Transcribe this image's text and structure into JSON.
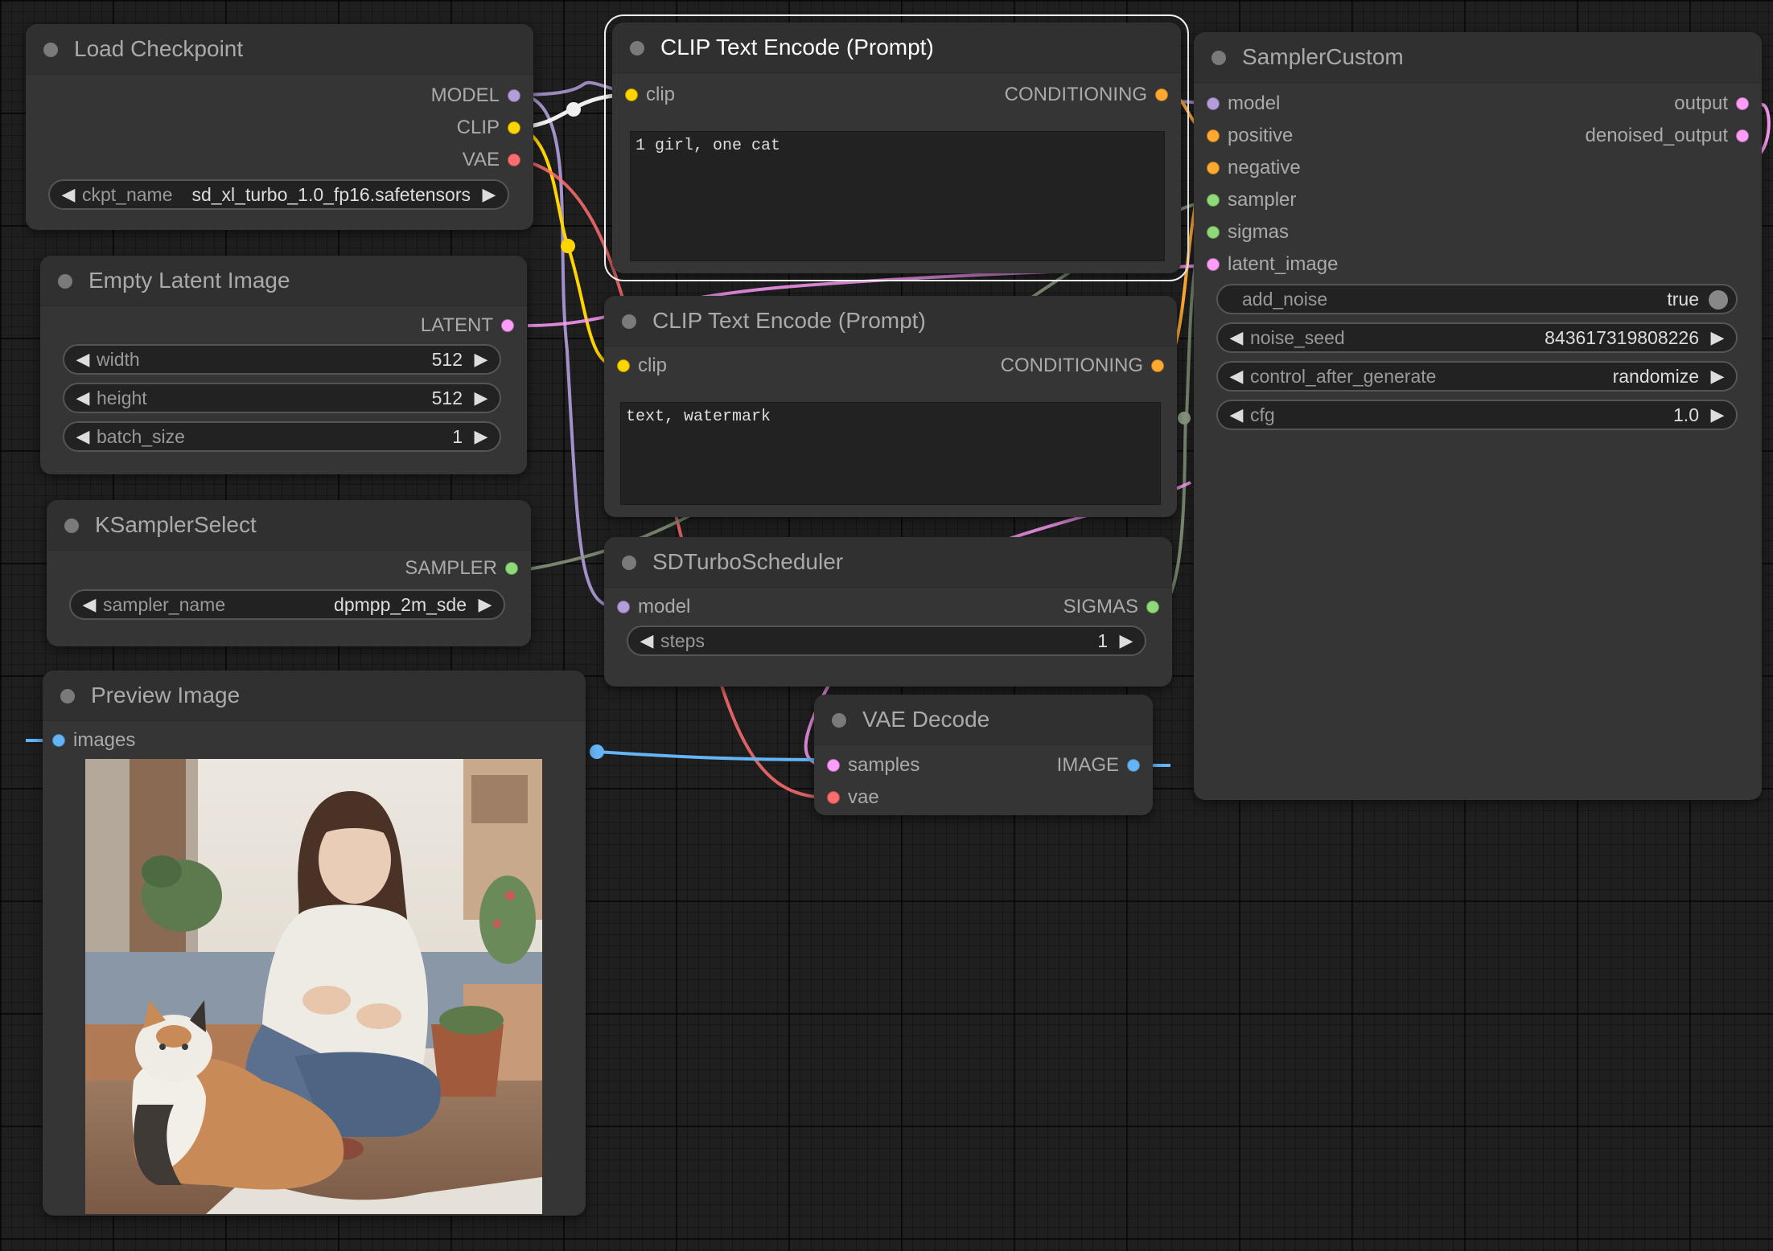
{
  "nodes": {
    "load_checkpoint": {
      "title": "Load Checkpoint",
      "outputs": [
        "MODEL",
        "CLIP",
        "VAE"
      ],
      "ckpt_label": "ckpt_name",
      "ckpt_value": "sd_xl_turbo_1.0_fp16.safetensors"
    },
    "clip_pos": {
      "title": "CLIP Text Encode (Prompt)",
      "input": "clip",
      "output": "CONDITIONING",
      "text": "1 girl, one cat"
    },
    "clip_neg": {
      "title": "CLIP Text Encode (Prompt)",
      "input": "clip",
      "output": "CONDITIONING",
      "text": "text, watermark"
    },
    "sampler_custom": {
      "title": "SamplerCustom",
      "inputs": [
        "model",
        "positive",
        "negative",
        "sampler",
        "sigmas",
        "latent_image"
      ],
      "outputs": [
        "output",
        "denoised_output"
      ],
      "widgets": {
        "add_noise": {
          "label": "add_noise",
          "value": "true"
        },
        "noise_seed": {
          "label": "noise_seed",
          "value": "843617319808226"
        },
        "control_after_generate": {
          "label": "control_after_generate",
          "value": "randomize"
        },
        "cfg": {
          "label": "cfg",
          "value": "1.0"
        }
      }
    },
    "empty_latent": {
      "title": "Empty Latent Image",
      "output": "LATENT",
      "widgets": {
        "width": {
          "label": "width",
          "value": "512"
        },
        "height": {
          "label": "height",
          "value": "512"
        },
        "batch_size": {
          "label": "batch_size",
          "value": "1"
        }
      }
    },
    "ksampler_select": {
      "title": "KSamplerSelect",
      "output": "SAMPLER",
      "sampler_label": "sampler_name",
      "sampler_value": "dpmpp_2m_sde"
    },
    "sd_turbo": {
      "title": "SDTurboScheduler",
      "input": "model",
      "output": "SIGMAS",
      "steps_label": "steps",
      "steps_value": "1"
    },
    "preview": {
      "title": "Preview Image",
      "input": "images"
    },
    "vae_decode": {
      "title": "VAE Decode",
      "inputs": [
        "samples",
        "vae"
      ],
      "output": "IMAGE"
    }
  },
  "colors": {
    "model": "#b39ddb",
    "clip": "#ffd500",
    "vae": "#ff6e6e",
    "conditioning": "#ffa931",
    "latent": "#ff9cf9",
    "sampler": "#8fda78",
    "sigmas": "#8fda78",
    "image": "#64b5f6"
  }
}
